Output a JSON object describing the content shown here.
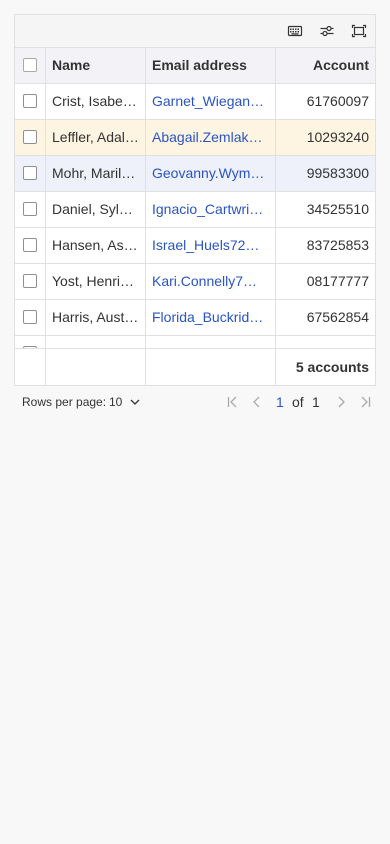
{
  "toolbar": {
    "icons": [
      "keyboard-icon",
      "filter-settings-icon",
      "fullscreen-icon"
    ]
  },
  "table": {
    "columns": {
      "name": "Name",
      "email": "Email address",
      "account": "Account"
    },
    "rows": [
      {
        "name": "Crist, Isabe…",
        "email": "Garnet_Wiegan…",
        "account": "61760097",
        "state": "normal"
      },
      {
        "name": "Leffler, Adal…",
        "email": "Abagail.Zemlak…",
        "account": "10293240",
        "state": "selected"
      },
      {
        "name": "Mohr, Maril…",
        "email": "Geovanny.Wym…",
        "account": "99583300",
        "state": "hover"
      },
      {
        "name": "Daniel, Syl…",
        "email": "Ignacio_Cartwri…",
        "account": "34525510",
        "state": "normal"
      },
      {
        "name": "Hansen, As…",
        "email": "Israel_Huels72…",
        "account": "83725853",
        "state": "normal"
      },
      {
        "name": "Yost, Henri…",
        "email": "Kari.Connelly7…",
        "account": "08177777",
        "state": "normal"
      },
      {
        "name": "Harris, Aust…",
        "email": "Florida_Buckrid…",
        "account": "67562854",
        "state": "normal"
      },
      {
        "name": "",
        "email": "",
        "account": "",
        "state": "normal"
      }
    ],
    "footer_count": "5 accounts"
  },
  "pagination": {
    "rows_per_page_label": "Rows per page:",
    "rows_per_page_value": "10",
    "current_page": "1",
    "of_label": "of",
    "total_pages": "1"
  },
  "colors": {
    "link": "#2a54c4",
    "selected_row": "#fdf5e1",
    "hover_row": "#eef1fa"
  }
}
